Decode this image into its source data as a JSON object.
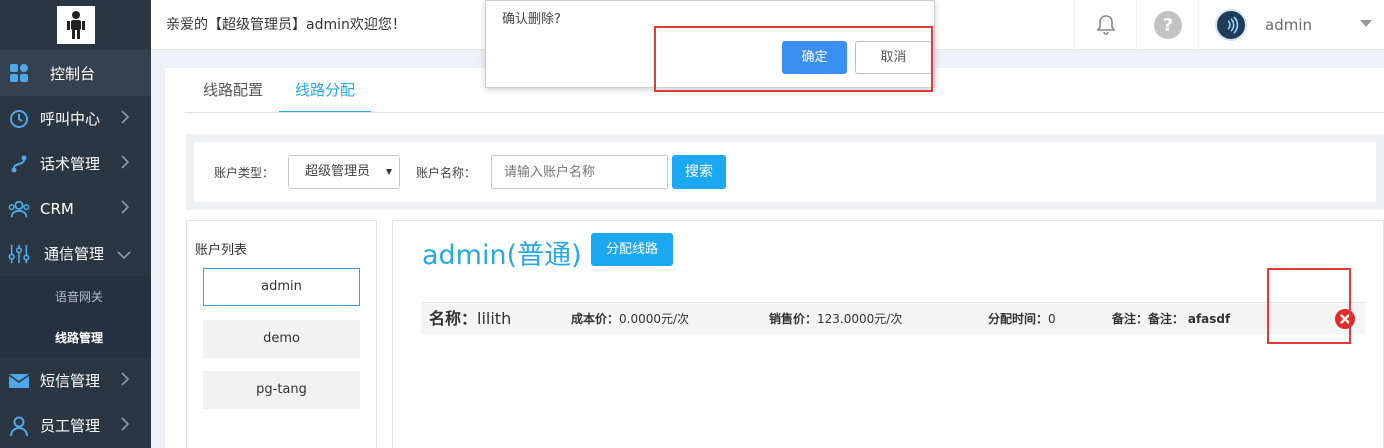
{
  "sidebar": {
    "items": [
      {
        "label": "控制台",
        "icon": "dashboard-icon"
      },
      {
        "label": "呼叫中心",
        "icon": "clock-icon"
      },
      {
        "label": "话术管理",
        "icon": "flow-icon"
      },
      {
        "label": "CRM",
        "icon": "users-icon"
      },
      {
        "label": "通信管理",
        "icon": "sliders-icon"
      },
      {
        "label": "短信管理",
        "icon": "mail-icon"
      },
      {
        "label": "员工管理",
        "icon": "user-icon"
      }
    ],
    "sub_items": [
      {
        "label": "语音网关"
      },
      {
        "label": "线路管理"
      }
    ]
  },
  "topbar": {
    "welcome": "亲爱的【超级管理员】admin欢迎您！",
    "username": "admin"
  },
  "tabs": [
    {
      "label": "线路配置"
    },
    {
      "label": "线路分配"
    }
  ],
  "filter": {
    "account_type_label": "账户类型：",
    "account_type_value": "超级管理员",
    "account_name_label": "账户名称：",
    "account_name_placeholder": "请输入账户名称",
    "search_label": "搜索"
  },
  "account_list": {
    "title": "账户列表",
    "items": [
      "admin",
      "demo",
      "pg-tang"
    ]
  },
  "detail": {
    "title": "admin(普通)",
    "assign_label": "分配线路",
    "row": {
      "name_label": "名称：",
      "name_value": "lilith",
      "cost_label": "成本价：",
      "cost_value": "0.0000元/次",
      "sale_label": "销售价：",
      "sale_value": "123.0000元/次",
      "time_label": "分配时间：",
      "time_value": "0",
      "remark_label": "备注：备注：",
      "remark_value": "afasdf"
    }
  },
  "dialog": {
    "message": "确认删除?",
    "ok_label": "确定",
    "cancel_label": "取消"
  },
  "colors": {
    "sidebar_bg": "#2b3643",
    "accent": "#27a9e3",
    "button": "#1ca9f4",
    "highlight": "#e53935",
    "delete": "#e12a2a"
  }
}
